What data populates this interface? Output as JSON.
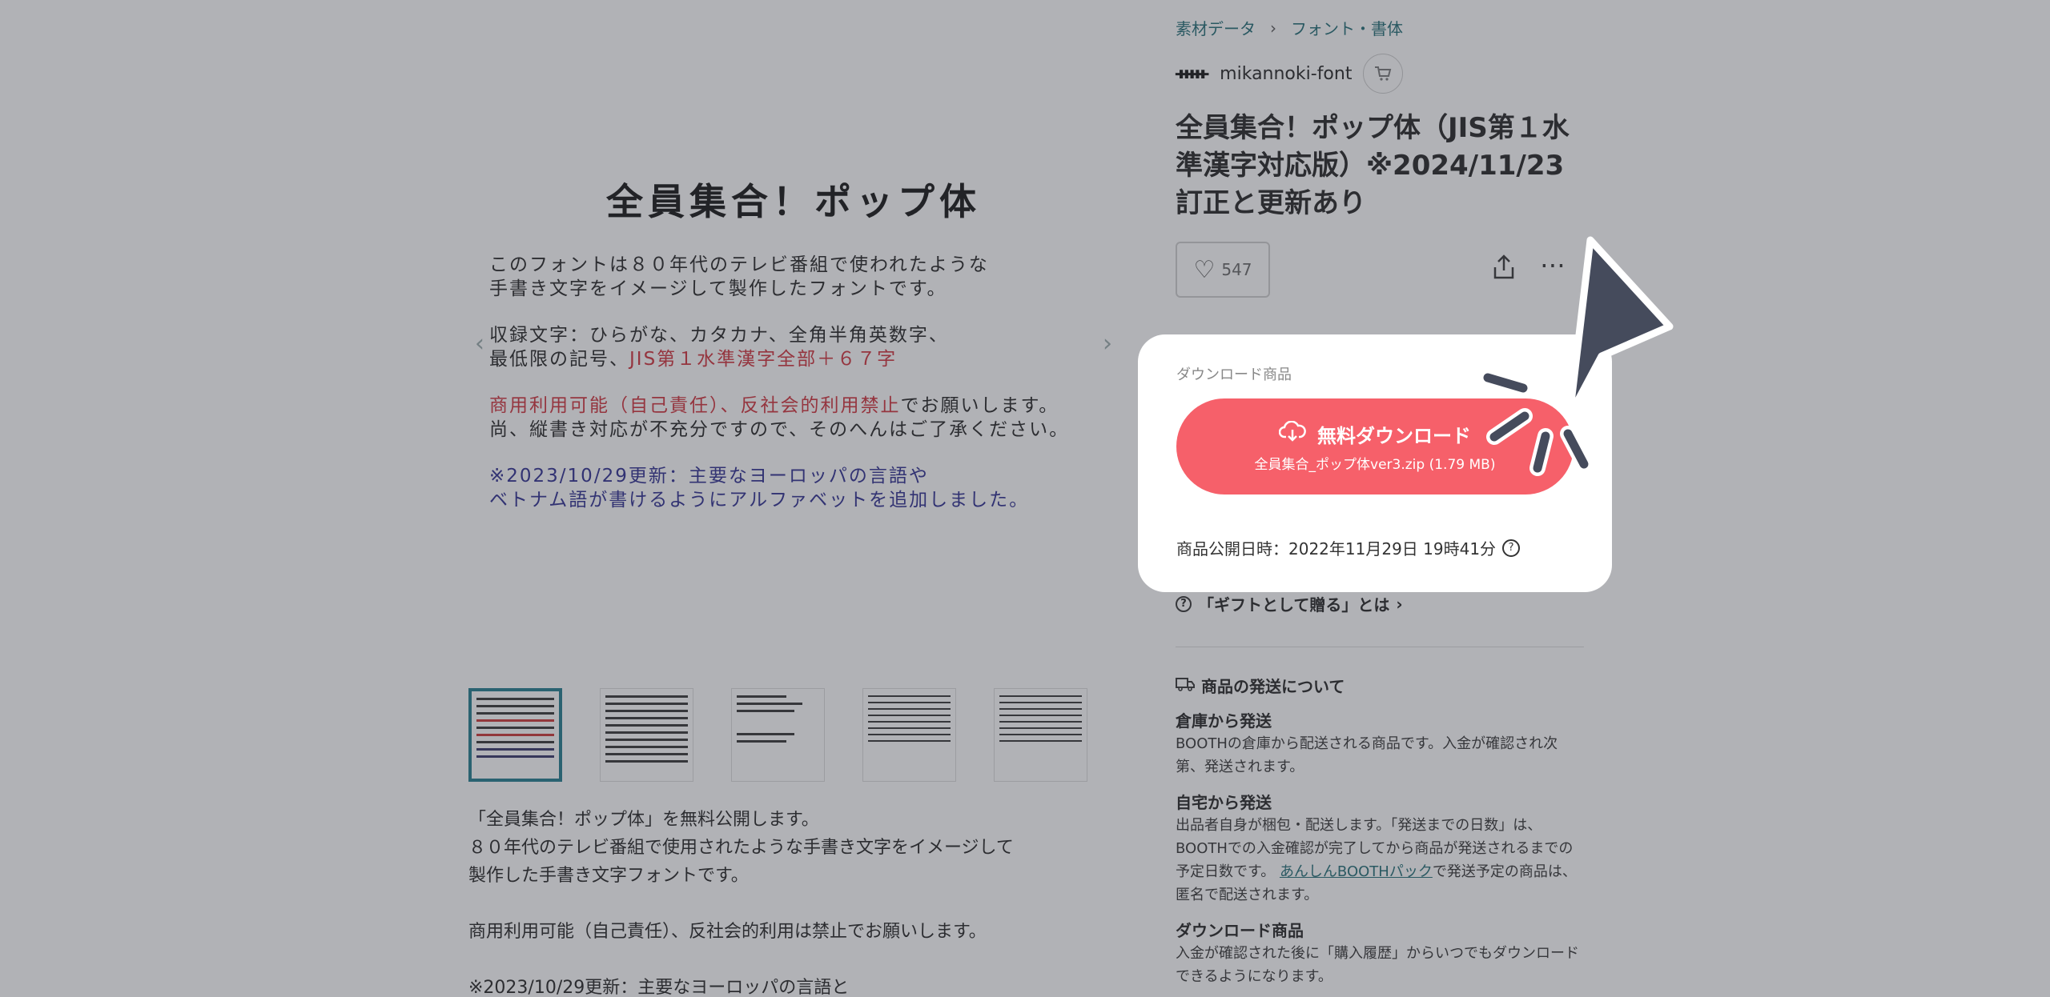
{
  "breadcrumb": {
    "items": [
      "素材データ",
      "フォント・書体"
    ],
    "separator": "›"
  },
  "shop": {
    "logo": "ᚔ",
    "name": "mikannoki-font",
    "cart_icon": "cart-icon"
  },
  "product": {
    "title": "全員集合！ポップ体（JIS第１水準漢字対応版）※2024/11/23訂正と更新あり",
    "likes": "547"
  },
  "gallery": {
    "preview_title": "全員集合！ポップ体",
    "preview_lines_1": [
      "このフォントは８０年代のテレビ番組で使われたような",
      "手書き文字をイメージして製作したフォントです。"
    ],
    "preview_lines_2a": "収録文字：ひらがな、カタカナ、全角半角英数字、",
    "preview_lines_2b_black": "最低限の記号、",
    "preview_lines_2b_red": "JIS第１水準漢字全部＋６７字",
    "preview_lines_3a_red": "商用利用可能（自己責任）、反社会的利用禁止",
    "preview_lines_3a_black": "でお願いします。",
    "preview_lines_3b": "尚、縦書き対応が不充分ですので、そのへんはご了承ください。",
    "preview_lines_4": [
      "※2023/10/29更新：主要なヨーロッパの言語や",
      "ベトナム語が書けるようにアルファベットを追加しました。"
    ],
    "prev_arrow": "‹",
    "next_arrow": "›"
  },
  "description": {
    "lines": [
      "「全員集合！ポップ体」を無料公開します。",
      "８０年代のテレビ番組で使用されたような手書き文字をイメージして",
      "製作した手書き文字フォントです。",
      "",
      "商用利用可能（自己責任）、反社会的利用は禁止でお願いします。",
      "",
      "※2023/10/29更新：主要なヨーロッパの言語と"
    ]
  },
  "download_card": {
    "label": "ダウンロード商品",
    "button_label": "無料ダウンロード",
    "file_info": "全員集合_ポップ体ver3.zip (1.79 MB)",
    "published": "商品公開日時：2022年11月29日 19時41分",
    "help_glyph": "?"
  },
  "gift": {
    "label": "「ギフトとして贈る」とは",
    "chevron": "›",
    "help_glyph": "?"
  },
  "shipping": {
    "heading": "商品の発送について",
    "sections": [
      {
        "title": "倉庫から発送",
        "body": "BOOTHの倉庫から配送される商品です。入金が確認され次第、発送されます。"
      },
      {
        "title": "自宅から発送",
        "body": "出品者自身が梱包・配送します。「発送までの日数」は、BOOTHでの入金確認が完了してから商品が発送されるまでの予定日数です。",
        "link": "あんしんBOOTHパック",
        "link_suffix": "で発送予定の商品は、匿名で配送されます。"
      },
      {
        "title": "ダウンロード商品",
        "body": "入金が確認された後に「購入履歴」からいつでもダウンロードできるようになります。"
      }
    ]
  },
  "colors": {
    "accent_download": "#f6606a",
    "link": "#1f6b74",
    "overlay": "rgba(60,62,72,0.40)",
    "pointer": "#454b5c"
  }
}
